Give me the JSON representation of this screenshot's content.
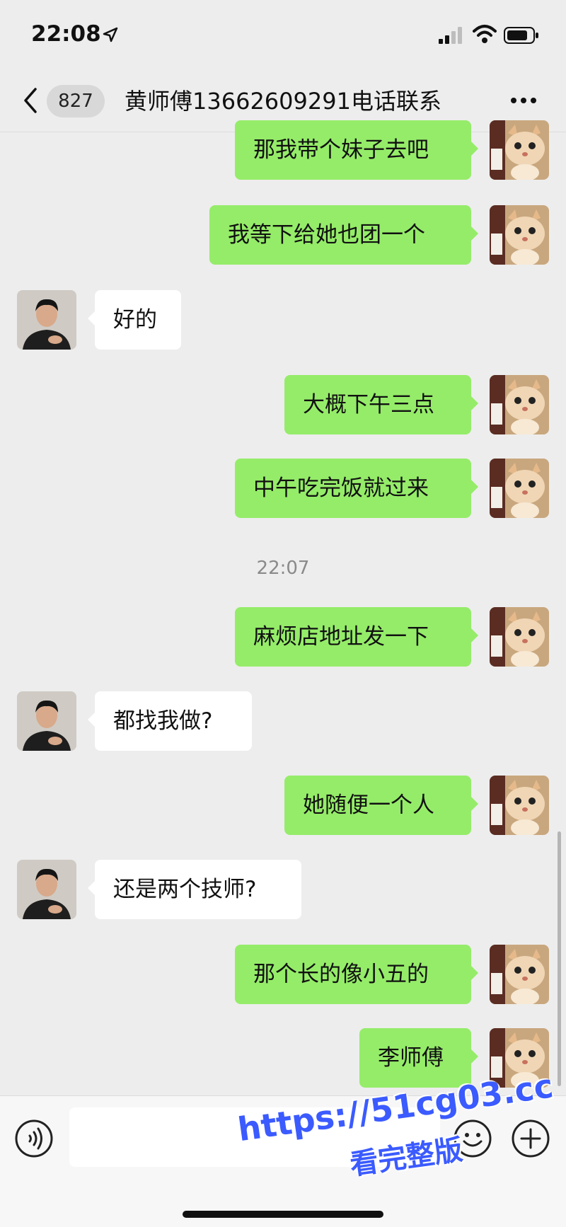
{
  "status_bar": {
    "time": "22:08"
  },
  "nav": {
    "unread_count": "827",
    "title": "黄师傅13662609291电话联系"
  },
  "messages": [
    {
      "side": "out",
      "text": "那我带个妹子去吧"
    },
    {
      "side": "out",
      "text": "我等下给她也团一个"
    },
    {
      "side": "in",
      "text": "好的"
    },
    {
      "side": "out",
      "text": "大概下午三点"
    },
    {
      "side": "out",
      "text": "中午吃完饭就过来"
    },
    {
      "side": "out",
      "text": "麻烦店地址发一下"
    },
    {
      "side": "in",
      "text": "都找我做?"
    },
    {
      "side": "out",
      "text": "她随便一个人"
    },
    {
      "side": "in",
      "text": "还是两个技师?"
    },
    {
      "side": "out",
      "text": "那个长的像小五的"
    },
    {
      "side": "out",
      "text": "李师傅"
    }
  ],
  "timestamp": "22:07",
  "input": {
    "placeholder": ""
  },
  "watermark": {
    "url": "https://51cg03.cc",
    "caption": "看完整版"
  },
  "colors": {
    "outgoing_bubble": "#95ec69",
    "incoming_bubble": "#ffffff",
    "background": "#ededed",
    "watermark": "#3b5bff"
  }
}
